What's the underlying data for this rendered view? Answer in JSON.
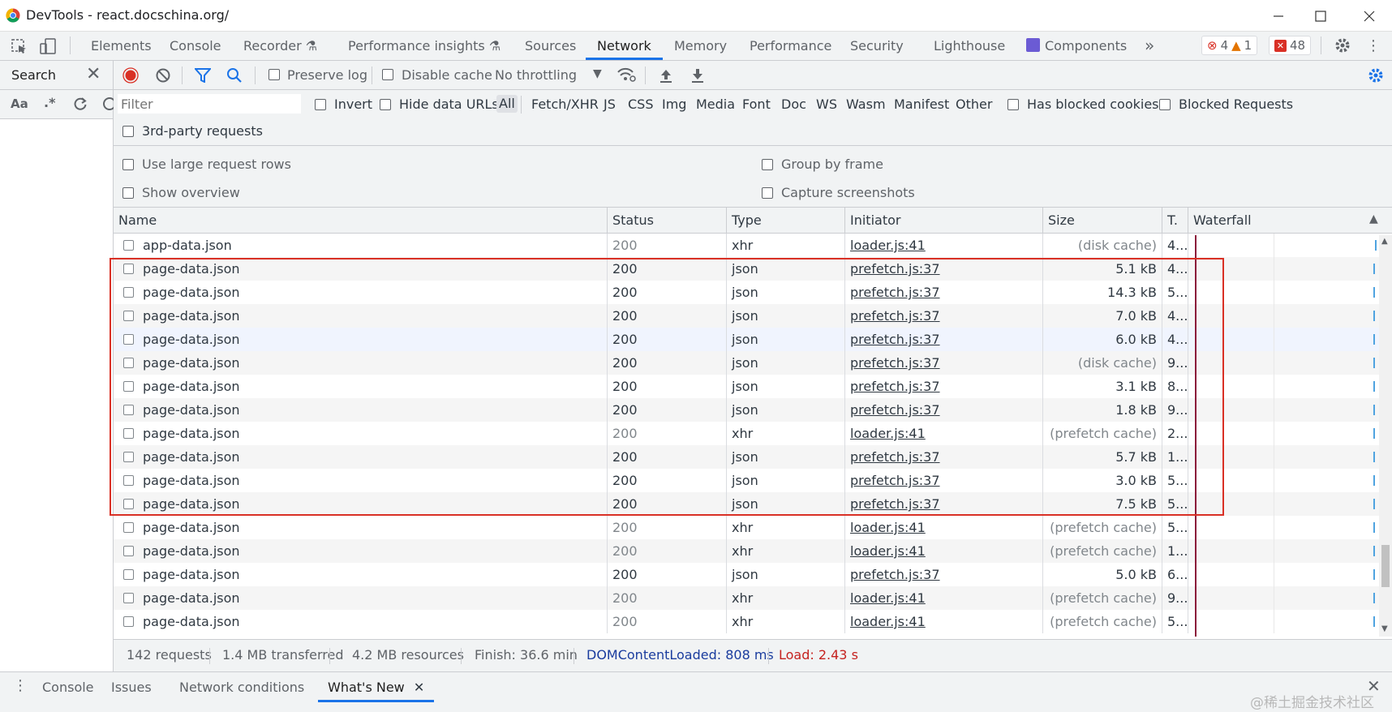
{
  "window": {
    "title": "DevTools - react.docschina.org/"
  },
  "tabs": [
    {
      "label": "Elements"
    },
    {
      "label": "Console"
    },
    {
      "label": "Recorder"
    },
    {
      "label": "Performance insights"
    },
    {
      "label": "Sources"
    },
    {
      "label": "Network"
    },
    {
      "label": "Memory"
    },
    {
      "label": "Performance"
    },
    {
      "label": "Security"
    },
    {
      "label": "Lighthouse"
    },
    {
      "label": "Components"
    }
  ],
  "more_tabs": "»",
  "badges": {
    "errors": "4",
    "warnings": "1",
    "issues": "48"
  },
  "search_panel": {
    "title": "Search",
    "case_label": "Aa",
    "regex_label": ".*"
  },
  "toolbar": {
    "preserve_log": "Preserve log",
    "disable_cache": "Disable cache",
    "throttling": "No throttling"
  },
  "filter": {
    "placeholder": "Filter",
    "invert": "Invert",
    "hide_data_urls": "Hide data URLs",
    "types": [
      "All",
      "Fetch/XHR",
      "JS",
      "CSS",
      "Img",
      "Media",
      "Font",
      "Doc",
      "WS",
      "Wasm",
      "Manifest",
      "Other"
    ],
    "selected_type": "All",
    "has_blocked_cookies": "Has blocked cookies",
    "blocked_requests": "Blocked Requests",
    "third_party": "3rd-party requests"
  },
  "settings": {
    "large_rows": "Use large request rows",
    "show_overview": "Show overview",
    "group_by_frame": "Group by frame",
    "capture_screenshots": "Capture screenshots"
  },
  "columns": {
    "name": "Name",
    "status": "Status",
    "type": "Type",
    "initiator": "Initiator",
    "size": "Size",
    "time": "T.",
    "waterfall": "Waterfall"
  },
  "rows": [
    {
      "name": "app-data.json",
      "status": "200",
      "type": "xhr",
      "initiator": "loader.js:41",
      "size": "(disk cache)",
      "time": "4..."
    },
    {
      "name": "page-data.json",
      "status": "200",
      "type": "json",
      "initiator": "prefetch.js:37",
      "size": "5.1 kB",
      "time": "4..."
    },
    {
      "name": "page-data.json",
      "status": "200",
      "type": "json",
      "initiator": "prefetch.js:37",
      "size": "14.3 kB",
      "time": "5..."
    },
    {
      "name": "page-data.json",
      "status": "200",
      "type": "json",
      "initiator": "prefetch.js:37",
      "size": "7.0 kB",
      "time": "4..."
    },
    {
      "name": "page-data.json",
      "status": "200",
      "type": "json",
      "initiator": "prefetch.js:37",
      "size": "6.0 kB",
      "time": "4..."
    },
    {
      "name": "page-data.json",
      "status": "200",
      "type": "json",
      "initiator": "prefetch.js:37",
      "size": "(disk cache)",
      "time": "9..."
    },
    {
      "name": "page-data.json",
      "status": "200",
      "type": "json",
      "initiator": "prefetch.js:37",
      "size": "3.1 kB",
      "time": "8..."
    },
    {
      "name": "page-data.json",
      "status": "200",
      "type": "json",
      "initiator": "prefetch.js:37",
      "size": "1.8 kB",
      "time": "9..."
    },
    {
      "name": "page-data.json",
      "status": "200",
      "type": "xhr",
      "initiator": "loader.js:41",
      "size": "(prefetch cache)",
      "time": "2..."
    },
    {
      "name": "page-data.json",
      "status": "200",
      "type": "json",
      "initiator": "prefetch.js:37",
      "size": "5.7 kB",
      "time": "1..."
    },
    {
      "name": "page-data.json",
      "status": "200",
      "type": "json",
      "initiator": "prefetch.js:37",
      "size": "3.0 kB",
      "time": "5..."
    },
    {
      "name": "page-data.json",
      "status": "200",
      "type": "json",
      "initiator": "prefetch.js:37",
      "size": "7.5 kB",
      "time": "5..."
    },
    {
      "name": "page-data.json",
      "status": "200",
      "type": "xhr",
      "initiator": "loader.js:41",
      "size": "(prefetch cache)",
      "time": "5..."
    },
    {
      "name": "page-data.json",
      "status": "200",
      "type": "xhr",
      "initiator": "loader.js:41",
      "size": "(prefetch cache)",
      "time": "1..."
    },
    {
      "name": "page-data.json",
      "status": "200",
      "type": "json",
      "initiator": "prefetch.js:37",
      "size": "5.0 kB",
      "time": "6..."
    },
    {
      "name": "page-data.json",
      "status": "200",
      "type": "xhr",
      "initiator": "loader.js:41",
      "size": "(prefetch cache)",
      "time": "9..."
    },
    {
      "name": "page-data.json",
      "status": "200",
      "type": "xhr",
      "initiator": "loader.js:41",
      "size": "(prefetch cache)",
      "time": "5..."
    }
  ],
  "status_bar": {
    "requests": "142 requests",
    "transferred": "1.4 MB transferred",
    "resources": "4.2 MB resources",
    "finish": "Finish: 36.6 min",
    "dom_content_loaded": "DOMContentLoaded: 808 ms",
    "load": "Load: 2.43 s"
  },
  "drawer": {
    "tabs": [
      "Console",
      "Issues",
      "Network conditions",
      "What's New"
    ],
    "active": "What's New"
  },
  "watermark": "@稀土掘金技术社区",
  "colors": {
    "accent": "#1a73e8",
    "record": "#d93025",
    "dcl": "#1a3c9e",
    "load": "#c5221f",
    "highlight_box": "#d93025"
  }
}
